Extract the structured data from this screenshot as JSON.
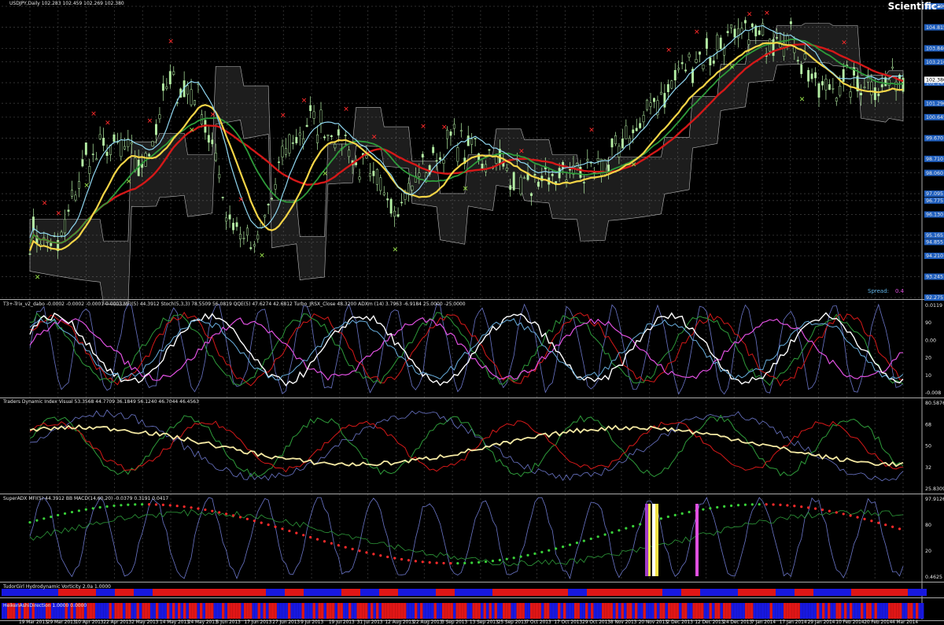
{
  "main": {
    "title_line": "USDJPY,Daily  102.283 102.459 102.269 102.380",
    "brand": "Scientific-",
    "spread_label": "Spread:",
    "spread_value": "0.4",
    "price_labels": [
      "105.790",
      "104.815",
      "103.840",
      "103.210",
      "102.245",
      "101.290",
      "100.645",
      "99.670",
      "98.710",
      "98.060",
      "97.095",
      "96.775",
      "96.130",
      "95.165",
      "94.855",
      "94.210",
      "93.245",
      "92.275"
    ],
    "current_price": "102.380"
  },
  "oscillator1": {
    "header": "T3+-Trix_v2_dabo -0.0002 -0.0002 -0.0001 0.0003  MFI(5) 44.3912  Stoch(5,3,3) 78.5509 56.0819  QQE(5) 47.6274 42.6812  Turbo_JRSX_Close 48.3200  ADXm (14) 3.7963 -6.9184 25.0000 -25.0000",
    "scale": [
      "0.0119",
      "90",
      "0.00",
      "20",
      "10",
      "-0.008"
    ]
  },
  "oscillator2": {
    "header": "Traders Dynamic Index Visual 53.3568 44.7709 36.1849 56.1240 46.7044 46.4563",
    "scale": [
      "80.5876",
      "68",
      "50",
      "32",
      "25.8309"
    ]
  },
  "oscillator3": {
    "header": "SuperADX  MFI(5) 44.3912  BB MACD(14,60,20) -0.0379 0.3191 0.0417",
    "scale": [
      "97.9126",
      "80",
      "20",
      "0.4625"
    ]
  },
  "bar1": {
    "header": "TudorGirl Hydrodynamic Vorticity 2.0a 1.0000"
  },
  "bar2": {
    "header": "HeikenAshiDirection 1.0000 0.0000"
  },
  "x_axis": {
    "labels": [
      "19 Mar 2013",
      "29 Mar 2013",
      "10 Apr 2013",
      "22 Apr 2013",
      "2 May 2013",
      "14 May 2013",
      "24 May 2013",
      "5 Jun 2013",
      "17 Jun 2013",
      "27 Jun 2013",
      "9 Jul 2013",
      "19 Jul 2013",
      "31 Jul 2013",
      "12 Aug 2013",
      "22 Aug 2013",
      "3 Sep 2013",
      "13 Sep 2013",
      "25 Sep 2013",
      "7 Oct 2013",
      "17 Oct 2013",
      "29 Oct 2013",
      "8 Nov 2013",
      "20 Nov 2013",
      "2 Dec 2013",
      "12 Dec 2013",
      "24 Dec 2013",
      "7 Jan 2014",
      "17 Jan 2014",
      "29 Jan 2014",
      "10 Feb 2014",
      "20 Feb 2014",
      "4 Mar 2014"
    ]
  },
  "chart_data": {
    "type": "line",
    "title": "USDJPY,Daily",
    "x": [
      "19 Mar 2013",
      "29 Mar 2013",
      "10 Apr 2013",
      "22 Apr 2013",
      "2 May 2013",
      "14 May 2013",
      "24 May 2013",
      "5 Jun 2013",
      "17 Jun 2013",
      "27 Jun 2013",
      "9 Jul 2013",
      "19 Jul 2013",
      "31 Jul 2013",
      "12 Aug 2013",
      "22 Aug 2013",
      "3 Sep 2013",
      "13 Sep 2013",
      "25 Sep 2013",
      "7 Oct 2013",
      "17 Oct 2013",
      "29 Oct 2013",
      "8 Nov 2013",
      "20 Nov 2013",
      "2 Dec 2013",
      "12 Dec 2013",
      "24 Dec 2013",
      "7 Jan 2014",
      "17 Jan 2014",
      "29 Jan 2014",
      "10 Feb 2014",
      "20 Feb 2014",
      "4 Mar 2014"
    ],
    "series": [
      {
        "name": "",
        "values": [
          95.3,
          94.3,
          98.9,
          99.3,
          98.3,
          102.4,
          101.5,
          96.2,
          94.5,
          98.8,
          100.5,
          99.6,
          98.0,
          96.5,
          98.3,
          99.5,
          99.0,
          98.3,
          97.3,
          98.2,
          98.2,
          99.1,
          101.0,
          102.5,
          103.6,
          104.3,
          104.4,
          104.3,
          102.0,
          102.2,
          102.3,
          102.4
        ]
      }
    ],
    "ylim": [
      92.275,
      105.79
    ],
    "xlabel": "",
    "ylabel": "",
    "grid": true,
    "colors": {
      "background": "#000000",
      "candle": "#b5f0a5",
      "cloud": "#b9b9b9",
      "red_line": "#d51818",
      "green_line": "#2e9b3a",
      "yellow_line": "#f5d547",
      "blue_line": "#8fd6f0",
      "buy_marker": "#9ae34c",
      "sell_marker": "#ff2a2a",
      "price_box": "#1f5fbf",
      "magenta": "#e050e0"
    }
  }
}
